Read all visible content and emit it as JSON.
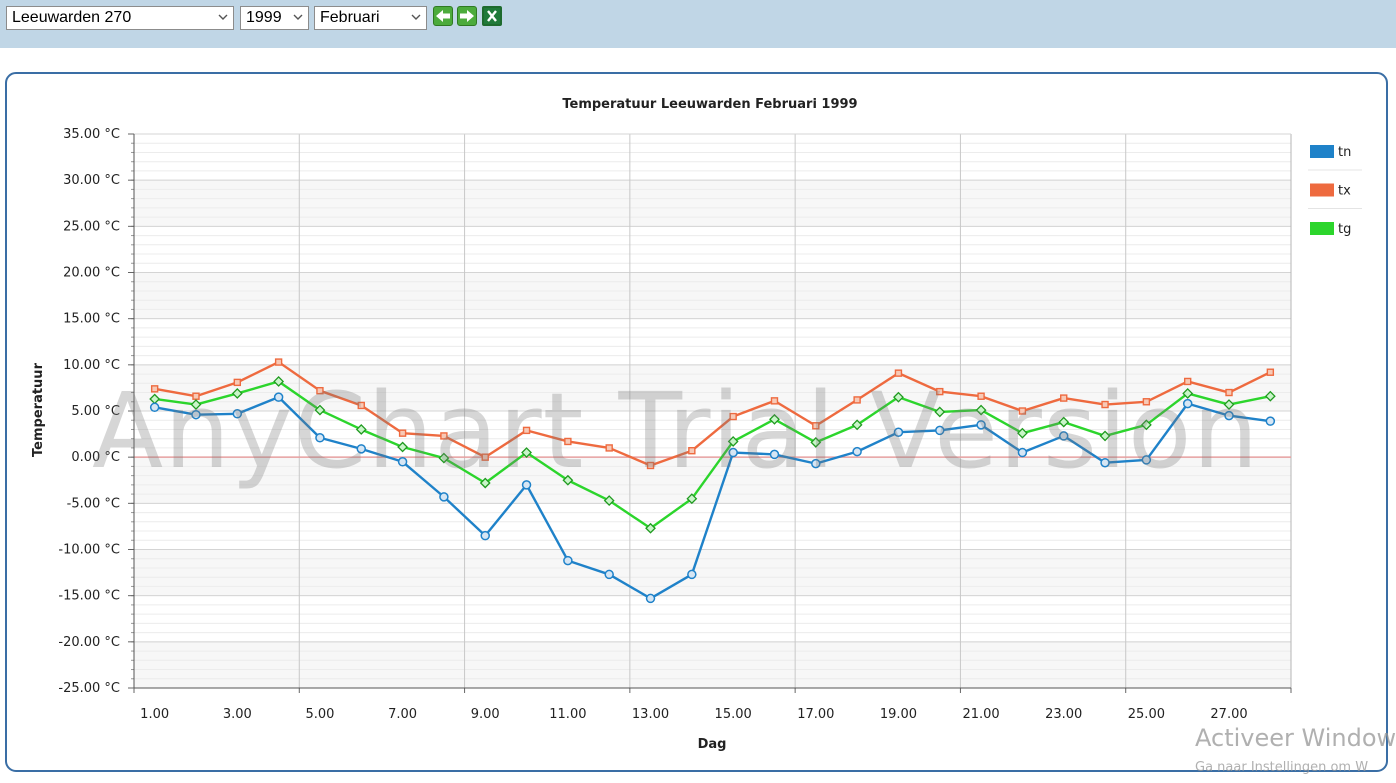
{
  "toolbar": {
    "station": "Leeuwarden 270",
    "year": "1999",
    "month": "Februari"
  },
  "watermark": "AnyChart Trial Version",
  "os_watermark": {
    "line1": "Activeer Windows",
    "line2": "Ga naar Instellingen om W"
  },
  "colors": {
    "tn": "#1f82c9",
    "tx": "#ee6a3f",
    "tg": "#2cd52c",
    "zero_line": "#e8a0a0"
  },
  "chart_data": {
    "type": "line",
    "title": "Temperatuur Leeuwarden Februari 1999",
    "xlabel": "Dag",
    "ylabel": "Temperatuur",
    "ylim": [
      -25,
      35
    ],
    "y_tick_step": 5,
    "y_ticks": [
      "35.00 °C",
      "30.00 °C",
      "25.00 °C",
      "20.00 °C",
      "15.00 °C",
      "10.00 °C",
      "5.00 °C",
      "0.00 °C",
      "-5.00 °C",
      "-10.00 °C",
      "-15.00 °C",
      "-20.00 °C",
      "-25.00 °C"
    ],
    "x_ticks": [
      "1.00",
      "3.00",
      "5.00",
      "7.00",
      "9.00",
      "11.00",
      "13.00",
      "15.00",
      "17.00",
      "19.00",
      "21.00",
      "23.00",
      "25.00",
      "27.00"
    ],
    "x": [
      1,
      2,
      3,
      4,
      5,
      6,
      7,
      8,
      9,
      10,
      11,
      12,
      13,
      14,
      15,
      16,
      17,
      18,
      19,
      20,
      21,
      22,
      23,
      24,
      25,
      26,
      27,
      28
    ],
    "grid": true,
    "legend_position": "right",
    "series": [
      {
        "name": "tn",
        "marker": "circle",
        "values": [
          5.4,
          4.6,
          4.7,
          6.5,
          2.1,
          0.9,
          -0.5,
          -4.3,
          -8.5,
          -3.0,
          -11.2,
          -12.7,
          -15.3,
          -12.7,
          0.5,
          0.3,
          -0.7,
          0.6,
          2.7,
          2.9,
          3.5,
          0.5,
          2.3,
          -0.6,
          -0.3,
          5.8,
          4.5,
          3.9
        ]
      },
      {
        "name": "tx",
        "marker": "square",
        "values": [
          7.4,
          6.6,
          8.1,
          10.3,
          7.2,
          5.6,
          2.6,
          2.3,
          0.0,
          2.9,
          1.7,
          1.0,
          -0.9,
          0.7,
          4.4,
          6.1,
          3.4,
          6.2,
          9.1,
          7.1,
          6.6,
          5.0,
          6.4,
          5.7,
          6.0,
          8.2,
          7.0,
          9.2
        ]
      },
      {
        "name": "tg",
        "marker": "diamond",
        "values": [
          6.3,
          5.7,
          6.9,
          8.2,
          5.1,
          3.0,
          1.1,
          -0.1,
          -2.8,
          0.5,
          -2.5,
          -4.7,
          -7.7,
          -4.5,
          1.7,
          4.1,
          1.6,
          3.5,
          6.5,
          4.9,
          5.1,
          2.6,
          3.8,
          2.3,
          3.5,
          6.9,
          5.7,
          6.6
        ]
      }
    ]
  }
}
